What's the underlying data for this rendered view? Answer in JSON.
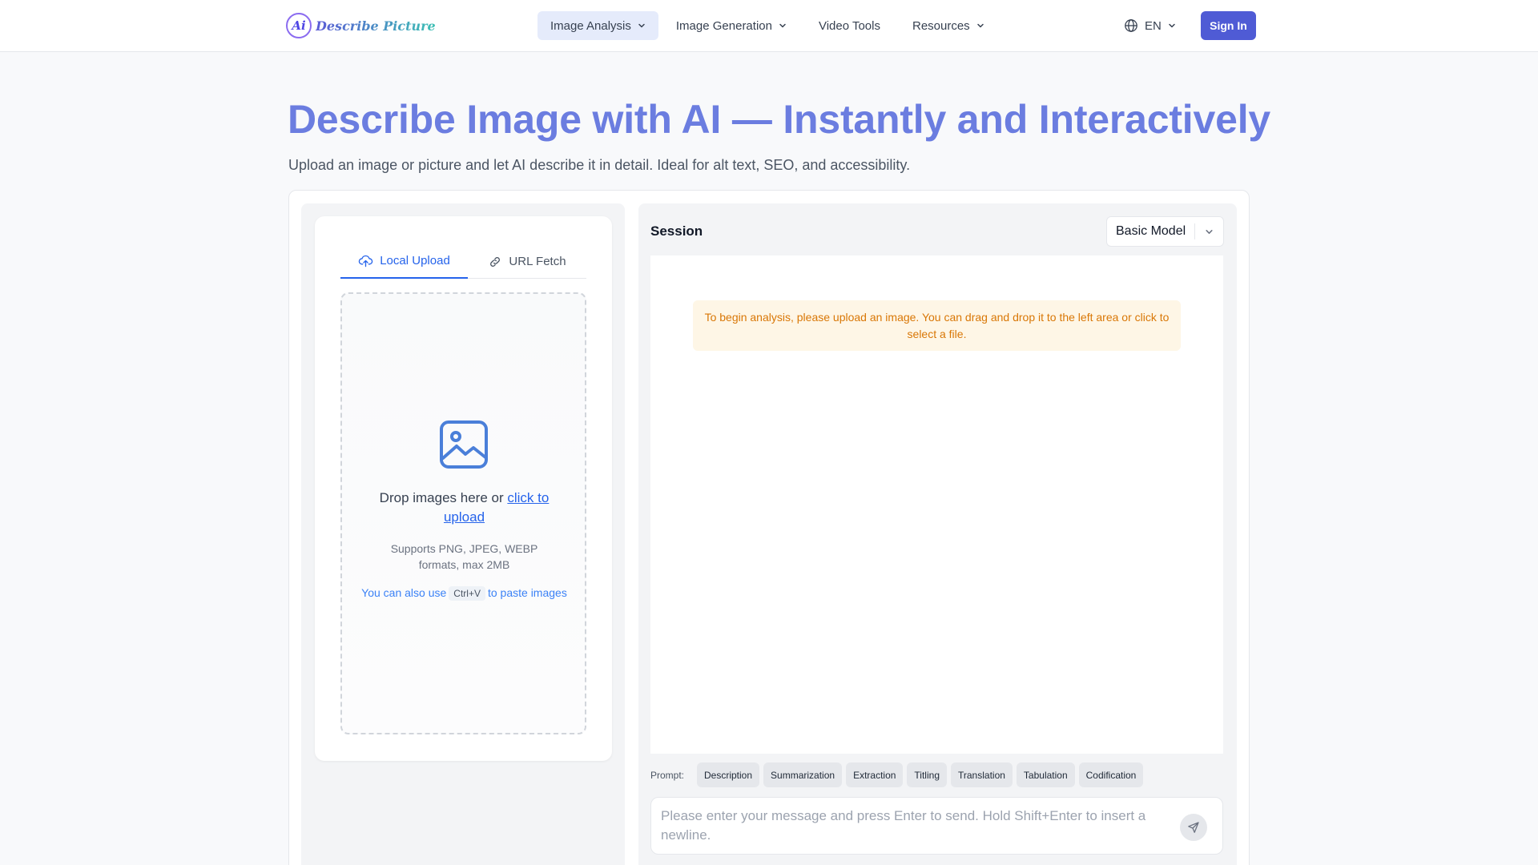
{
  "header": {
    "logo_mark": "Ai",
    "logo_text": "Describe Picture",
    "nav": [
      {
        "label": "Image Analysis",
        "dropdown": true,
        "active": true
      },
      {
        "label": "Image Generation",
        "dropdown": true,
        "active": false
      },
      {
        "label": "Video Tools",
        "dropdown": false,
        "active": false
      },
      {
        "label": "Resources",
        "dropdown": true,
        "active": false
      }
    ],
    "language": "EN",
    "signin_label": "Sign In"
  },
  "hero": {
    "title": "Describe Image with AI — Instantly and Interactively",
    "subtitle": "Upload an image or picture and let AI describe it in detail. Ideal for alt text, SEO, and accessibility."
  },
  "upload": {
    "tabs": [
      {
        "label": "Local Upload",
        "icon": "cloud-upload-icon",
        "active": true
      },
      {
        "label": "URL Fetch",
        "icon": "link-icon",
        "active": false
      }
    ],
    "drop_text": "Drop images here or ",
    "drop_link": "click to upload",
    "formats": "Supports PNG, JPEG, WEBP formats, max 2MB",
    "paste_before": "You can also use",
    "paste_key": "Ctrl+V",
    "paste_after": "to paste images"
  },
  "session": {
    "label": "Session",
    "model_selected": "Basic Model",
    "notice": "To begin analysis, please upload an image. You can drag and drop it to the left area or click to select a file.",
    "prompt_label": "Prompt:",
    "prompts": [
      "Description",
      "Summarization",
      "Extraction",
      "Titling",
      "Translation",
      "Tabulation",
      "Codification"
    ],
    "input_placeholder": "Please enter your message and press Enter to send. Hold Shift+Enter to insert a newline."
  },
  "colors": {
    "accent": "#4f5bd5",
    "title": "#6b7de0",
    "link": "#2563eb",
    "notice_bg": "#fef6e6",
    "notice_text": "#d97706"
  }
}
